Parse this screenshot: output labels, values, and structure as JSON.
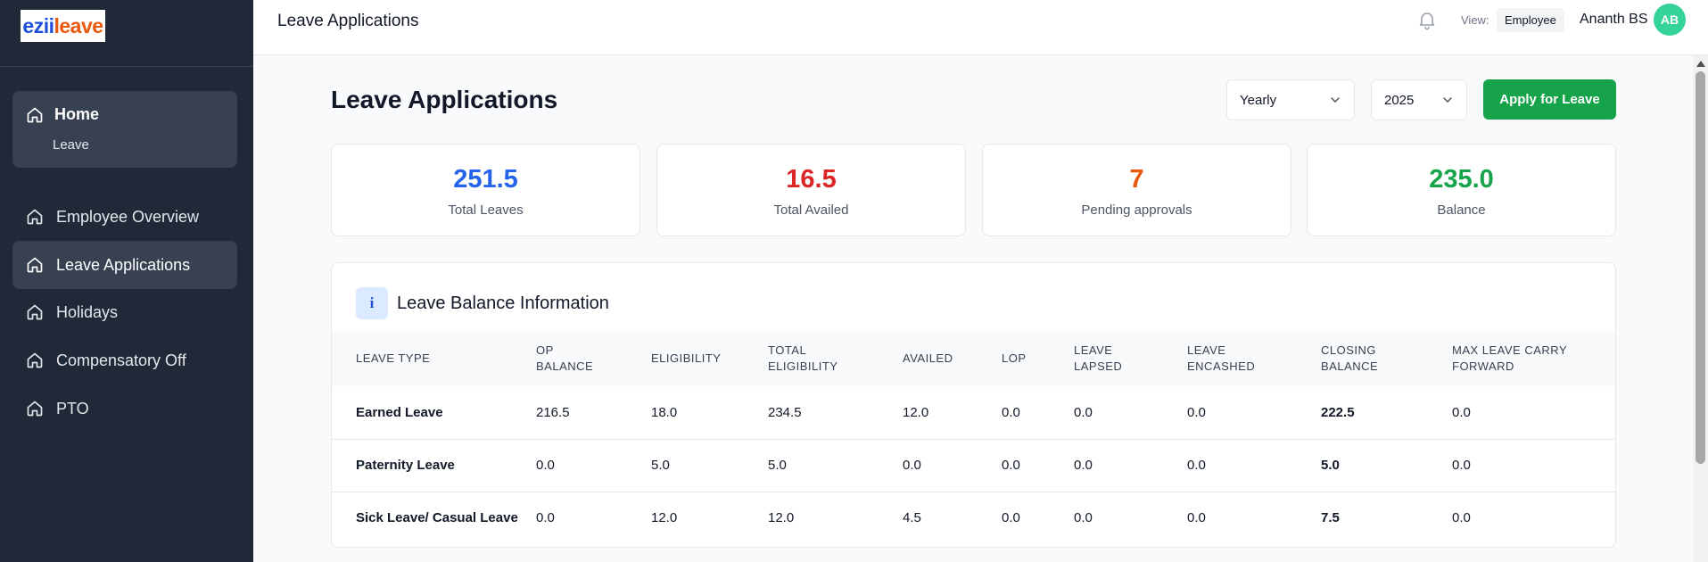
{
  "brand": {
    "logo_part1": "ezii",
    "logo_part2": "leave"
  },
  "sidebar": {
    "home": {
      "label": "Home",
      "sub": "Leave"
    },
    "items": [
      {
        "label": "Employee Overview",
        "active": false
      },
      {
        "label": "Leave Applications",
        "active": true
      },
      {
        "label": "Holidays",
        "active": false
      },
      {
        "label": "Compensatory Off",
        "active": false
      },
      {
        "label": "PTO",
        "active": false
      }
    ]
  },
  "header": {
    "title": "Leave Applications",
    "view_label": "View:",
    "view_value": "Employee",
    "user_name": "Ananth BS",
    "user_initials": "AB"
  },
  "main": {
    "title": "Leave Applications",
    "period": "Yearly",
    "year": "2025",
    "apply_label": "Apply for Leave",
    "stats": [
      {
        "value": "251.5",
        "label": "Total Leaves",
        "color": "#2563eb"
      },
      {
        "value": "16.5",
        "label": "Total Availed",
        "color": "#dc2626"
      },
      {
        "value": "7",
        "label": "Pending approvals",
        "color": "#ea580c"
      },
      {
        "value": "235.0",
        "label": "Balance",
        "color": "#16a34a"
      }
    ],
    "balance": {
      "icon": "i",
      "title": "Leave Balance Information",
      "headers": [
        [
          "LEAVE TYPE"
        ],
        [
          "OP",
          "BALANCE"
        ],
        [
          "ELIGIBILITY"
        ],
        [
          "TOTAL",
          "ELIGIBILITY"
        ],
        [
          "AVAILED"
        ],
        [
          "LOP"
        ],
        [
          "LEAVE",
          "LAPSED"
        ],
        [
          "LEAVE",
          "ENCASHED"
        ],
        [
          "CLOSING",
          "BALANCE"
        ],
        [
          "MAX LEAVE CARRY",
          "FORWARD"
        ]
      ],
      "rows": [
        [
          "Earned Leave",
          "216.5",
          "18.0",
          "234.5",
          "12.0",
          "0.0",
          "0.0",
          "0.0",
          "222.5",
          "0.0"
        ],
        [
          "Paternity Leave",
          "0.0",
          "5.0",
          "5.0",
          "0.0",
          "0.0",
          "0.0",
          "0.0",
          "5.0",
          "0.0"
        ],
        [
          "Sick Leave/ Casual Leave",
          "0.0",
          "12.0",
          "12.0",
          "4.5",
          "0.0",
          "0.0",
          "0.0",
          "7.5",
          "0.0"
        ]
      ]
    }
  },
  "icons": {
    "nav": "house-icon",
    "notifications": "bell-icon",
    "dropdown": "chevron-down-icon",
    "info": "info-icon"
  }
}
